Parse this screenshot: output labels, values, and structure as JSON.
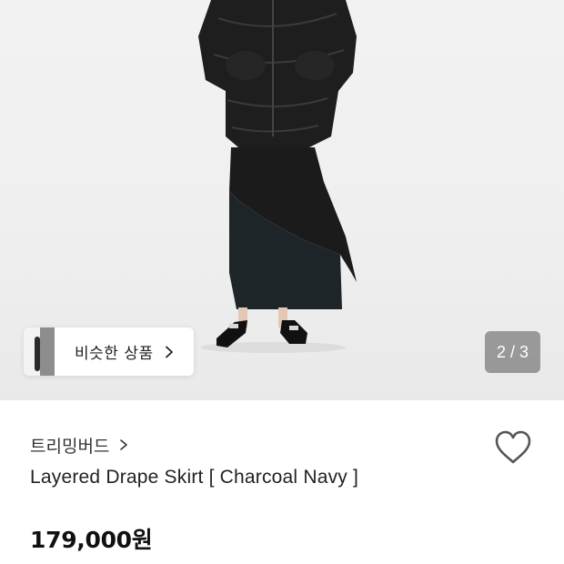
{
  "gallery": {
    "image_alt": "model wearing layered drape skirt",
    "similar_products_label": "비슷한 상품",
    "page_counter": "2 / 3"
  },
  "product": {
    "brand": "트리밍버드",
    "name": "Layered Drape Skirt [ Charcoal Navy ]",
    "price": "179,000원"
  },
  "icons": {
    "similar_arrow": "chevron-right-icon",
    "brand_arrow": "chevron-right-icon",
    "wishlist": "heart-outline-icon"
  },
  "colors": {
    "background": "#ffffff",
    "counter_bg": "#787878",
    "text_primary": "#222222"
  }
}
